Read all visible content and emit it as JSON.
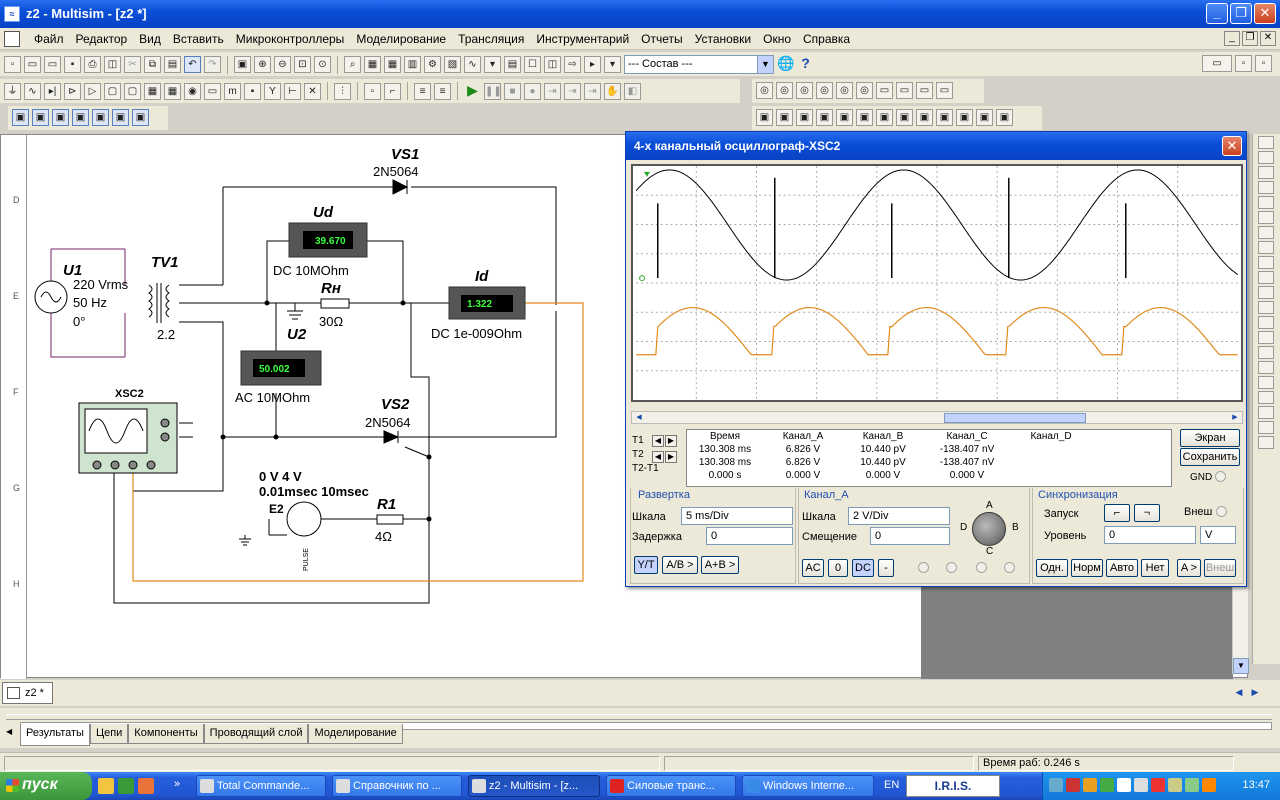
{
  "window": {
    "title": "z2 - Multisim - [z2 *]",
    "min_label": "_",
    "max_label": "❐",
    "close_label": "✕"
  },
  "menu": [
    "Файл",
    "Редактор",
    "Вид",
    "Вставить",
    "Микроконтроллеры",
    "Моделирование",
    "Трансляция",
    "Инструментарий",
    "Отчеты",
    "Установки",
    "Окно",
    "Справка"
  ],
  "toolbar": {
    "combo_value": "--- Состав ---",
    "help_label": "?"
  },
  "ruler": [
    "D",
    "E",
    "F",
    "G",
    "H"
  ],
  "schematic": {
    "vs1_name": "VS1",
    "vs1_model": "2N5064",
    "vs2_name": "VS2",
    "vs2_model": "2N5064",
    "ud_name": "Ud",
    "ud_value": "39.670",
    "ud_mode": "DC  10MOhm",
    "id_name": "Id",
    "id_value": "1.322",
    "id_mode": "DC  1e-009Ohm",
    "u2_name": "U2",
    "u2_value": "50.002",
    "u2_mode": "AC  10MOhm",
    "u1_name": "U1",
    "u1_line1": "220 Vrms",
    "u1_line2": "50 Hz",
    "u1_line3": "0°",
    "tv1_name": "TV1",
    "tv1_ratio": "2.2",
    "rn_name": "Rн",
    "rn_value": "30Ω",
    "xsc_name": "XSC2",
    "pulse_line1": "0 V 4 V",
    "pulse_line2": "0.01msec 10msec",
    "e2_name": "E2",
    "pulse_text": "PULSE",
    "r1_name": "R1",
    "r1_value": "4Ω"
  },
  "oscilloscope": {
    "title": "4-х канальный осциллограф-XSC2",
    "close_label": "✕",
    "t1_label": "T1",
    "t2_label": "T2",
    "t2t1_label": "T2-T1",
    "readout": {
      "headers": [
        "Время",
        "Канал_A",
        "Канал_B",
        "Канал_C",
        "Канал_D"
      ],
      "rows": [
        [
          "130.308 ms",
          "6.826 V",
          "10.440 pV",
          "-138.407 nV",
          ""
        ],
        [
          "130.308 ms",
          "6.826 V",
          "10.440 pV",
          "-138.407 nV",
          ""
        ],
        [
          "0.000 s",
          "0.000 V",
          "0.000 V",
          "0.000 V",
          ""
        ]
      ]
    },
    "screen_btn": "Экран",
    "save_btn": "Сохранить",
    "gnd_label": "GND",
    "sweep": {
      "title": "Развертка",
      "scale_label": "Шкала",
      "scale_value": "5 ms/Div",
      "delay_label": "Задержка",
      "delay_value": "0",
      "btn_yt": "Y/T",
      "btn_ab": "A/B >",
      "btn_apb": "A+B >"
    },
    "channel": {
      "title": "Канал_A",
      "scale_label": "Шкала",
      "scale_value": "2  V/Div",
      "offset_label": "Смещение",
      "offset_value": "0",
      "btn_ac": "AC",
      "btn_zero": "0",
      "btn_dc": "DC",
      "btn_minus": "-",
      "knob_a": "A",
      "knob_b": "B",
      "knob_c": "C",
      "knob_d": "D"
    },
    "trigger": {
      "title": "Синхронизация",
      "edge_label": "Запуск",
      "ext_label": "Внеш",
      "level_label": "Уровень",
      "level_value": "0",
      "level_unit": "V",
      "btn_single": "Одн.",
      "btn_norm": "Норм",
      "btn_auto": "Авто",
      "btn_none": "Нет",
      "btn_a": "A >",
      "btn_ext": "Внеш"
    },
    "trace_colors": {
      "channel_a": "#000000",
      "channel_b": "#e08a1a"
    }
  },
  "doc_tab": "z2 *",
  "bottom_tabs": [
    "Результаты",
    "Цепи",
    "Компоненты",
    "Проводящий слой",
    "Моделирование"
  ],
  "status": {
    "sim_time": "Время раб: 0.246 s"
  },
  "taskbar": {
    "start": "пуск",
    "tasks": [
      "Total Commande...",
      "Справочник по ...",
      "z2 - Multisim - [z...",
      "Силовые транс...",
      "Windows Interne..."
    ],
    "lang": "EN",
    "iris": "I.R.I.S.",
    "clock": "13:47"
  }
}
